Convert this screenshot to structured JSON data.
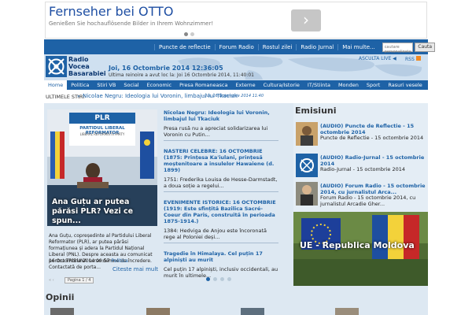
{
  "ad": {
    "title": "Fernseher bei OTTO",
    "text": "Genießen Sie hochauflösende Bilder in Ihrem Wohnzimmer!",
    "arrow": "›"
  },
  "topnav": {
    "items": [
      "Puncte de reflectie",
      "Forum Radio",
      "Rostul zilei",
      "Radio Jurnal",
      "Mai multe..."
    ],
    "search_placeholder": "cautare personalizata",
    "search_button": "Cauta"
  },
  "header": {
    "logo_line1": "Radio",
    "logo_line2": "Vocea",
    "logo_line3": "Basarabiei",
    "date": "Joi, 16 Octombrie 2014 12:36:05",
    "update": "Ultima reinoire a avut loc la: Joi 16 Octombrie 2014, 11:40:01",
    "listen": "ASCULTA LIVE",
    "rss": "RSS"
  },
  "menu": {
    "items": [
      "Home",
      "Politica",
      "Stiri VB",
      "Social",
      "Economic",
      "Presa Romaneasca",
      "Externe",
      "Cultura/Istorie",
      "IT/Stiinta",
      "Monden",
      "Sport",
      "Rasuri vesele"
    ]
  },
  "ticker": {
    "label": "ULTIMELE STIRI",
    "icon": "»",
    "text": "Nicolae Negru: Ideologia lui Voronin, limbajul lui Tkaciuk",
    "date": "- Joi, 16 Octombrie 2014 11:40"
  },
  "featured": {
    "banner_top": "PLR",
    "banner_sub": "PARTIDUL LIBERAL REFORMATOR",
    "banner_small": "LIBERAL REFORMISTS PARTY",
    "headline": "Ana Guțu ar putea părăsi PLR? Vezi ce spun...",
    "body": "Ana Guțu, copreședinte al Partidului Liberal Reformator (PLR), ar putea părăsi formațiunea și adera la Partidul Național Liberal (PNL). Despre aceasta au comunicat pentru TRIBUNA surse demne de încredere. Contactată de porta...",
    "date": "16 Octombrie 2014 09:57",
    "category": "Politica",
    "more": "Citeste mai mult"
  },
  "news": [
    {
      "title": "Nicolae Negru: Ideologia lui Voronin, limbajul lui Tkaciuk",
      "body": "Presa rusă nu a apreciat solidarizarea lui Voronin cu Putin..."
    },
    {
      "title": "NASTERI CELEBRE: 16 OCTOMBRIE (1875: Prințesa Ka'iulani, prințesă moștenitoare a insulelor Hawaiene (d. 1899)",
      "body": "1751: Frederika Louisa de Hesse-Darmstadt, a doua soție a regelui..."
    },
    {
      "title": "EVENIMENTE ISTORICE: 16 OCTOMBRIE (1919: Este sfințită Bazilica Sacré-Coeur din Paris, construită în perioada 1875-1914.)",
      "body": "1384: Hedviga de Anjou este încoronată rege al Poloniei deși..."
    },
    {
      "title": "Tragedie în Himalaya. Cel puțin 17 alpiniști au murit",
      "body": "Cel puțin 17 alpiniști, inclusiv occidentali, au murit în ultimele..."
    }
  ],
  "pager": {
    "arrows": "« ‹",
    "page": "Pagina 1 / 4"
  },
  "emisiuni": {
    "title": "Emisiuni",
    "items": [
      {
        "link": "(AUDIO) Puncte de Reflectie - 15 octombrie 2014",
        "sub": "Puncte de Reflectie - 15 octombrie 2014"
      },
      {
        "link": "(AUDIO) Radio-Jurnal - 15 octombrie 2014",
        "sub": "Radio-Jurnal - 15 octombrie 2014"
      },
      {
        "link": "(AUDIO) Forum Radio - 15 octombrie 2014, cu jurnalistul Arca...",
        "sub": "Forum Radio - 15 octombrie 2014, cu jurnalistul Arcadie Gher..."
      }
    ],
    "photo_caption": "UE - Republica Moldova"
  },
  "opinii": {
    "title": "Opinii"
  },
  "colors": {
    "brand_blue": "#1e62a6",
    "header_bg": "#cfe0f0",
    "content_bg": "#dde8f2"
  }
}
